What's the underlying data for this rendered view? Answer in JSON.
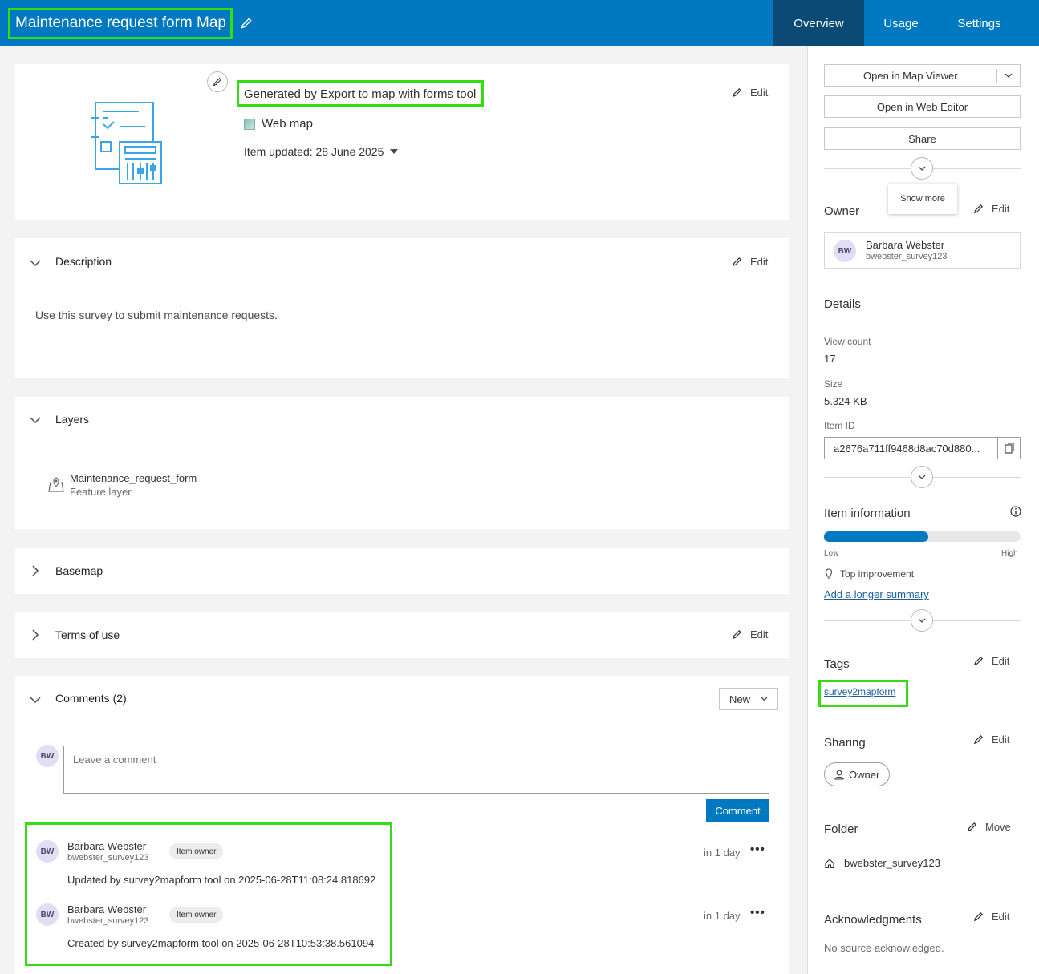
{
  "header": {
    "title": "Maintenance request form Map",
    "tabs": [
      "Overview",
      "Usage",
      "Settings"
    ]
  },
  "summary": {
    "snippet": "Generated by Export to map with forms tool",
    "type_label": "Web map",
    "updated": "Item updated: 28 June 2025",
    "edit_label": "Edit"
  },
  "description": {
    "title": "Description",
    "edit_label": "Edit",
    "text": "Use this survey to submit maintenance requests."
  },
  "layers": {
    "title": "Layers",
    "items": [
      {
        "name": "Maintenance_request_form",
        "type": "Feature layer"
      }
    ]
  },
  "basemap": {
    "title": "Basemap"
  },
  "terms": {
    "title": "Terms of use",
    "edit_label": "Edit"
  },
  "comments": {
    "title": "Comments (2)",
    "sort_label": "New",
    "placeholder": "Leave a comment",
    "submit_label": "Comment",
    "current_user_initials": "BW",
    "items": [
      {
        "initials": "BW",
        "name": "Barbara Webster",
        "username": "bwebster_survey123",
        "badge": "Item owner",
        "time": "in 1 day",
        "text": "Updated by survey2mapform tool on 2025-06-28T11:08:24.818692"
      },
      {
        "initials": "BW",
        "name": "Barbara Webster",
        "username": "bwebster_survey123",
        "badge": "Item owner",
        "time": "in 1 day",
        "text": "Created by survey2mapform tool on 2025-06-28T10:53:38.561094"
      }
    ]
  },
  "sidebar": {
    "open_map_viewer": "Open in Map Viewer",
    "open_web_editor": "Open in Web Editor",
    "share": "Share",
    "show_more_tooltip": "Show more",
    "owner": {
      "title": "Owner",
      "edit_label": "Edit",
      "initials": "BW",
      "name": "Barbara Webster",
      "username": "bwebster_survey123"
    },
    "details": {
      "title": "Details",
      "view_count_label": "View count",
      "view_count": "17",
      "size_label": "Size",
      "size": "5.324 KB",
      "item_id_label": "Item ID",
      "item_id": "a2676a711ff9468d8ac70d880..."
    },
    "item_information": {
      "title": "Item information",
      "score_fraction": 0.53,
      "low_label": "Low",
      "high_label": "High",
      "top_improvement": "Top improvement",
      "improvement_link": "Add a longer summary"
    },
    "tags": {
      "title": "Tags",
      "edit_label": "Edit",
      "items": [
        "survey2mapform"
      ]
    },
    "sharing": {
      "title": "Sharing",
      "edit_label": "Edit",
      "level": "Owner"
    },
    "folder": {
      "title": "Folder",
      "move_label": "Move",
      "name": "bwebster_survey123"
    },
    "acknowledgments": {
      "title": "Acknowledgments",
      "edit_label": "Edit",
      "text": "No source acknowledged."
    }
  },
  "colors": {
    "brand": "#0079c1",
    "nav_active": "#0b4a75",
    "highlight": "#33dd11",
    "link": "#1a5fa0"
  }
}
